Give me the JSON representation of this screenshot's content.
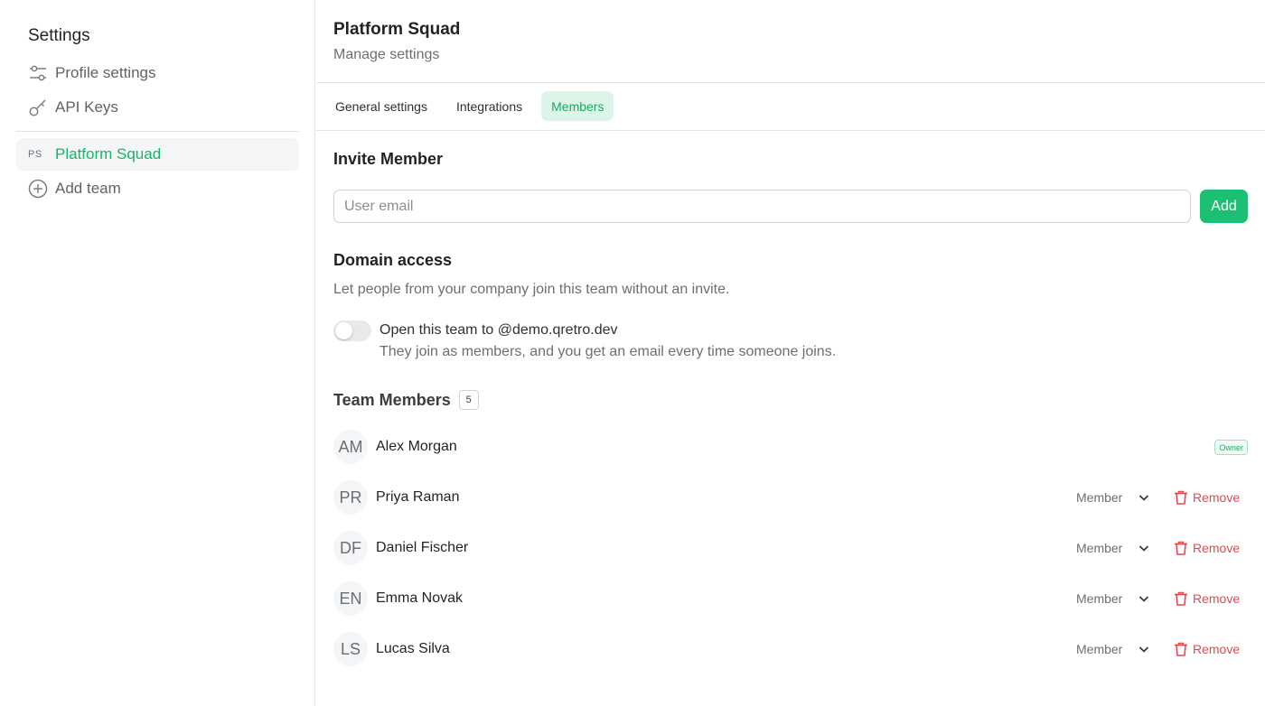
{
  "sidebar": {
    "title": "Settings",
    "items": [
      {
        "label": "Profile settings",
        "icon": "sliders-icon"
      },
      {
        "label": "API Keys",
        "icon": "key-icon"
      }
    ],
    "team": {
      "abbr": "PS",
      "name": "Platform Squad"
    },
    "add_team_label": "Add team"
  },
  "header": {
    "title": "Platform Squad",
    "subtitle": "Manage settings"
  },
  "tabs": [
    {
      "label": "General settings",
      "active": false
    },
    {
      "label": "Integrations",
      "active": false
    },
    {
      "label": "Members",
      "active": true
    }
  ],
  "invite": {
    "title": "Invite Member",
    "placeholder": "User email",
    "value": "",
    "button": "Add"
  },
  "domain": {
    "title": "Domain access",
    "description": "Let people from your company join this team without an invite.",
    "toggle_label": "Open this team to @demo.qretro.dev",
    "toggle_help": "They join as members, and you get an email every time someone joins.",
    "toggle_on": false
  },
  "team_members": {
    "title": "Team Members",
    "count": "5",
    "owner_badge": "Owner",
    "remove_label": "Remove",
    "members": [
      {
        "initials": "AM",
        "name": "Alex Morgan",
        "role": "Owner"
      },
      {
        "initials": "PR",
        "name": "Priya Raman",
        "role": "Member"
      },
      {
        "initials": "DF",
        "name": "Daniel Fischer",
        "role": "Member"
      },
      {
        "initials": "EN",
        "name": "Emma Novak",
        "role": "Member"
      },
      {
        "initials": "LS",
        "name": "Lucas Silva",
        "role": "Member"
      }
    ]
  },
  "colors": {
    "accent": "#1cc074",
    "accent_text": "#19a865",
    "danger": "#e5484d"
  }
}
